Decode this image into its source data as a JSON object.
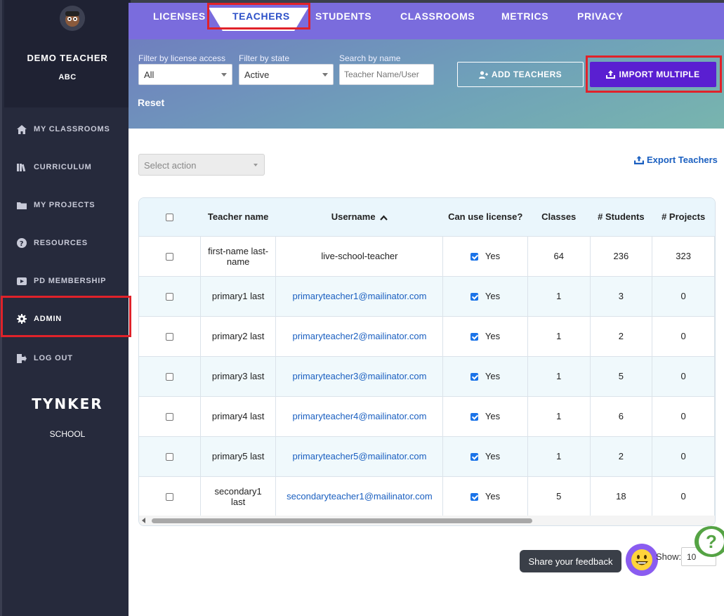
{
  "user": {
    "name": "DEMO TEACHER",
    "org": "ABC"
  },
  "sidebar": {
    "items": [
      {
        "label": "MY CLASSROOMS",
        "icon": "home-icon"
      },
      {
        "label": "CURRICULUM",
        "icon": "books-icon"
      },
      {
        "label": "MY PROJECTS",
        "icon": "folder-icon"
      },
      {
        "label": "RESOURCES",
        "icon": "question-icon"
      },
      {
        "label": "PD MEMBERSHIP",
        "icon": "video-icon"
      },
      {
        "label": "ADMIN",
        "icon": "gear-icon"
      },
      {
        "label": "LOG OUT",
        "icon": "logout-icon"
      }
    ],
    "brand": "TYNKER",
    "brand_sub": "SCHOOL"
  },
  "topnav": {
    "tabs": [
      "LICENSES",
      "TEACHERS",
      "STUDENTS",
      "CLASSROOMS",
      "METRICS",
      "PRIVACY"
    ],
    "active": "TEACHERS"
  },
  "filters": {
    "license_label": "Filter by license access",
    "license_value": "All",
    "state_label": "Filter by state",
    "state_value": "Active",
    "search_label": "Search by name",
    "search_placeholder": "Teacher Name/User",
    "reset": "Reset",
    "add_teachers": "ADD TEACHERS",
    "import_multiple": "IMPORT MULTIPLE"
  },
  "actions": {
    "select_placeholder": "Select action",
    "export": "Export Teachers"
  },
  "table": {
    "headers": [
      "Teacher name",
      "Username",
      "Can use license?",
      "Classes",
      "# Students",
      "# Projects"
    ],
    "rows": [
      {
        "name": "first-name last-name",
        "username": "live-school-teacher",
        "license": "Yes",
        "classes": "64",
        "students": "236",
        "projects": "323"
      },
      {
        "name": "primary1 last",
        "username": "primaryteacher1@mailinator.com",
        "license": "Yes",
        "classes": "1",
        "students": "3",
        "projects": "0"
      },
      {
        "name": "primary2 last",
        "username": "primaryteacher2@mailinator.com",
        "license": "Yes",
        "classes": "1",
        "students": "2",
        "projects": "0"
      },
      {
        "name": "primary3 last",
        "username": "primaryteacher3@mailinator.com",
        "license": "Yes",
        "classes": "1",
        "students": "5",
        "projects": "0"
      },
      {
        "name": "primary4 last",
        "username": "primaryteacher4@mailinator.com",
        "license": "Yes",
        "classes": "1",
        "students": "6",
        "projects": "0"
      },
      {
        "name": "primary5 last",
        "username": "primaryteacher5@mailinator.com",
        "license": "Yes",
        "classes": "1",
        "students": "2",
        "projects": "0"
      },
      {
        "name": "secondary1 last",
        "username": "secondaryteacher1@mailinator.com",
        "license": "Yes",
        "classes": "5",
        "students": "18",
        "projects": "0"
      }
    ]
  },
  "footer": {
    "feedback": "Share your feedback",
    "show_label": "Show:",
    "show_value": "10",
    "help": "?"
  }
}
